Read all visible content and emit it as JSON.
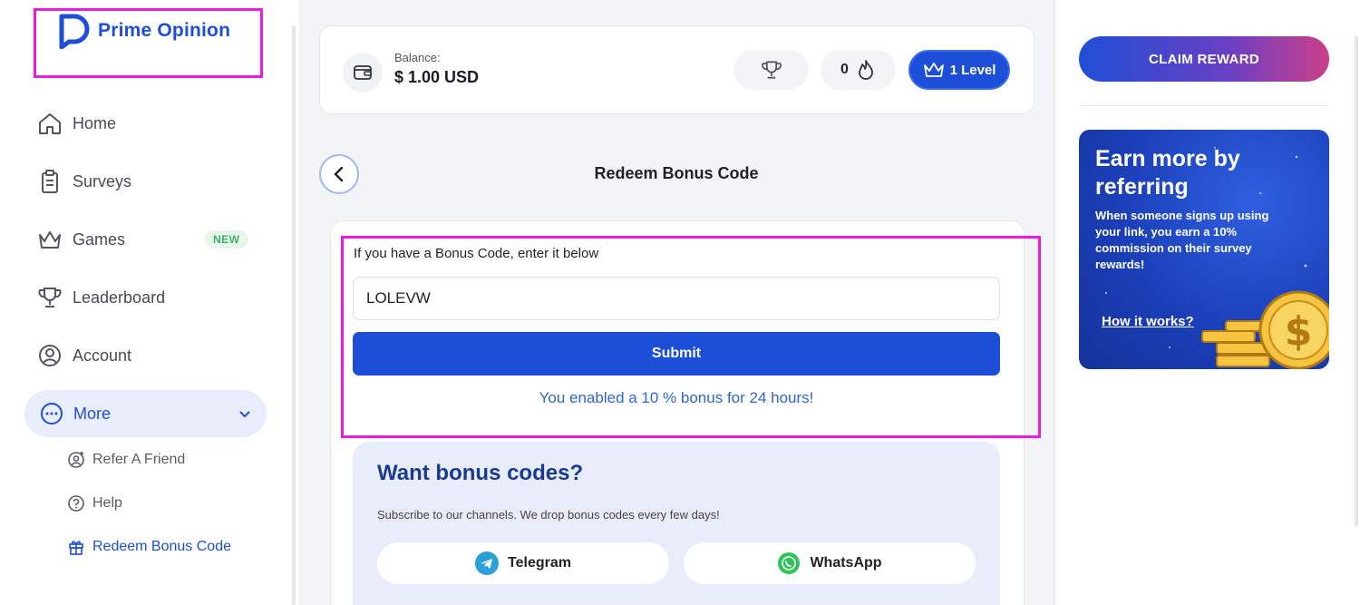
{
  "brand": {
    "name": "Prime Opinion",
    "color": "#1d4ed8"
  },
  "sidebar": {
    "items": [
      {
        "label": "Home",
        "icon": "home-icon"
      },
      {
        "label": "Surveys",
        "icon": "clipboard-icon"
      },
      {
        "label": "Games",
        "icon": "crown-icon",
        "badge": "NEW"
      },
      {
        "label": "Leaderboard",
        "icon": "trophy-icon"
      },
      {
        "label": "Account",
        "icon": "user-icon"
      }
    ],
    "more": {
      "label": "More",
      "icon": "more-dots-icon"
    },
    "sub_items": [
      {
        "label": "Refer A Friend",
        "icon": "user-plus-icon"
      },
      {
        "label": "Help",
        "icon": "help-icon"
      },
      {
        "label": "Redeem Bonus Code",
        "icon": "gift-icon",
        "active": true
      }
    ]
  },
  "header": {
    "balance_label": "Balance:",
    "balance_value": "$ 1.00 USD",
    "streak_count": "0",
    "level_label": "1 Level"
  },
  "page": {
    "title": "Redeem Bonus Code"
  },
  "form": {
    "label": "If you have a Bonus Code, enter it below",
    "code_value": "LOLEVW",
    "submit_label": "Submit",
    "success_message": "You enabled a 10 % bonus for 24 hours!"
  },
  "bonus_panel": {
    "title": "Want bonus codes?",
    "description": "Subscribe to our channels. We drop bonus codes every few days!",
    "telegram_label": "Telegram",
    "whatsapp_label": "WhatsApp"
  },
  "right": {
    "claim_label": "CLAIM REWARD",
    "refer_title": "Earn more by referring",
    "refer_desc": "When someone signs up using your link, you earn a 10% commission on their survey rewards!",
    "refer_link": "How it works?"
  },
  "colors": {
    "accent": "#1d4ed8",
    "highlight": "#ee1adc",
    "success_text": "#2f64d6",
    "new_badge": "#3fb06a"
  }
}
